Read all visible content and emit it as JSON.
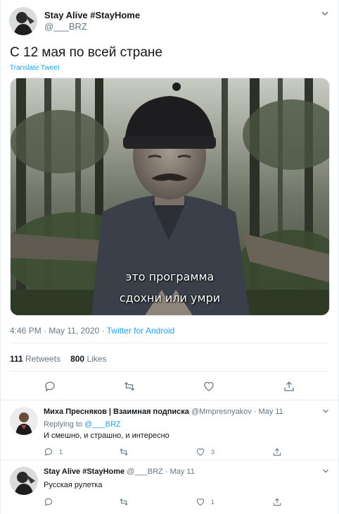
{
  "main_tweet": {
    "author_name": "Stay Alive #StayHome",
    "author_handle": "@___BRZ",
    "text": "С 12 мая по всей стране",
    "translate_label": "Translate Tweet",
    "media_subtitle_line1": "это программа",
    "media_subtitle_line2": "сдохни или умри",
    "time": "4:46 PM · May 11, 2020 · ",
    "source": "Twitter for Android",
    "retweets_count": "111",
    "retweets_label": "Retweets",
    "likes_count": "800",
    "likes_label": "Likes"
  },
  "replies": [
    {
      "author_name": "Миха Пресняков | Взаимная подписка",
      "author_handle": "@Mmpresnyakov · May 11",
      "replying_prefix": "Replying to ",
      "replying_to": "@___BRZ",
      "text": "И смешно, и страшно, и интересно",
      "reply_count": "1",
      "retweet_count": "",
      "like_count": "3"
    },
    {
      "author_name": "Stay Alive #StayHome",
      "author_handle": "@___BRZ · May 11",
      "text": "Русская рулетка",
      "reply_count": "",
      "retweet_count": "",
      "like_count": "1"
    }
  ],
  "icons": {
    "reply": "reply-icon",
    "retweet": "retweet-icon",
    "like": "heart-icon",
    "share": "share-icon",
    "more": "chevron-down-icon"
  },
  "colors": {
    "accent": "#1da1f2",
    "secondary_text": "#657786",
    "divider": "#e6ecf0"
  }
}
